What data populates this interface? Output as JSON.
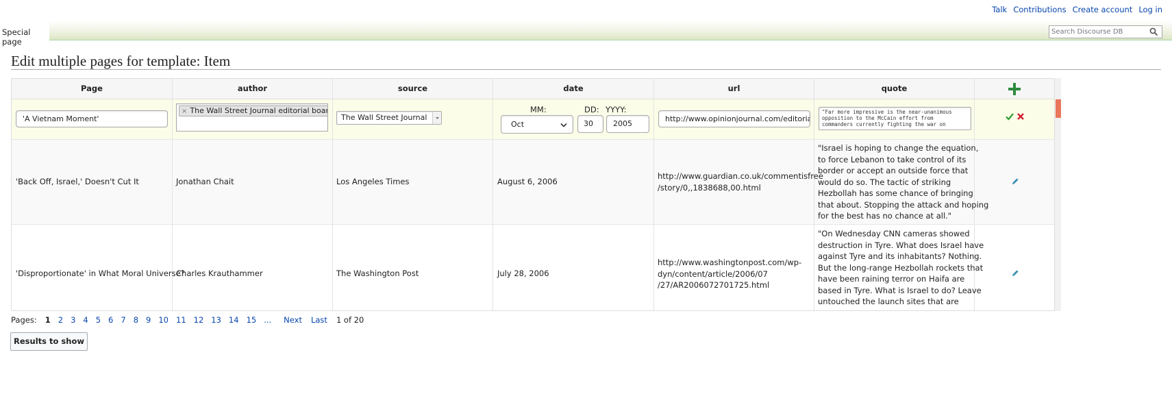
{
  "personal_nav": [
    "Talk",
    "Contributions",
    "Create account",
    "Log in"
  ],
  "tab_label": "Special page",
  "search": {
    "placeholder": "Search Discourse DB"
  },
  "page_title": "Edit multiple pages for template: Item",
  "columns": [
    "Page",
    "author",
    "source",
    "date",
    "url",
    "quote"
  ],
  "edit_row": {
    "page": "'A Vietnam Moment'",
    "author_token": "The Wall Street Journal editorial board",
    "source": "The Wall Street Journal",
    "date_labels": {
      "mm": "MM:",
      "dd": "DD:",
      "yyyy": "YYYY:"
    },
    "month": "Oct",
    "day": "30",
    "year": "2005",
    "url": "http://www.opinionjournal.com/editorial/fea",
    "quote": "\"Far more impressive is the near-unanimous opposition to the McCain effort from commanders currently fighting the war on"
  },
  "rows": [
    {
      "page": "'Back Off, Israel,' Doesn't Cut It",
      "author": "Jonathan Chait",
      "source": "Los Angeles Times",
      "date": "August 6, 2006",
      "url": [
        "http://www.guardian.co.uk/commentisfree",
        "/story/0,,1838688,00.html"
      ],
      "quote": [
        "\"Israel is hoping to change the equation,",
        "to force Lebanon to take control of its",
        "border or accept an outside force that",
        "would do so. The tactic of striking",
        "Hezbollah has some chance of bringing",
        "that about. Stopping the attack and hoping",
        "for the best has no chance at all.\""
      ]
    },
    {
      "page": "'Disproportionate' in What Moral Universe?",
      "author": "Charles Krauthammer",
      "source": "The Washington Post",
      "date": "July 28, 2006",
      "url": [
        "http://www.washingtonpost.com/wp-",
        "dyn/content/article/2006/07",
        "/27/AR2006072701725.html"
      ],
      "quote": [
        "\"On Wednesday CNN cameras showed",
        "destruction in Tyre. What does Israel have",
        "against Tyre and its inhabitants? Nothing.",
        "But the long-range Hezbollah rockets that",
        "have been raining terror on Haifa are",
        "based in Tyre. What is Israel to do? Leave",
        "untouched the launch sites that are"
      ]
    }
  ],
  "pager": {
    "label": "Pages:",
    "current": "1",
    "pages": [
      "2",
      "3",
      "4",
      "5",
      "6",
      "7",
      "8",
      "9",
      "10",
      "11",
      "12",
      "13",
      "14",
      "15"
    ],
    "ellipsis": "...",
    "next": "Next",
    "last": "Last",
    "count": "1 of 20"
  },
  "results_button": "Results to show",
  "colors": {
    "link": "#0645ad",
    "edit_row_bg": "#fbfde8",
    "add_icon": "#2e8b3d",
    "accept_icon": "#2e9b2e",
    "cancel_icon": "#d21f2f",
    "pencil_icon": "#3d8fb5",
    "scroll_thumb": "#e9775a"
  },
  "icons": [
    "add-row-icon",
    "accept-icon",
    "cancel-icon",
    "edit-pencil-icon",
    "search-icon",
    "dropdown-arrow-icon"
  ]
}
